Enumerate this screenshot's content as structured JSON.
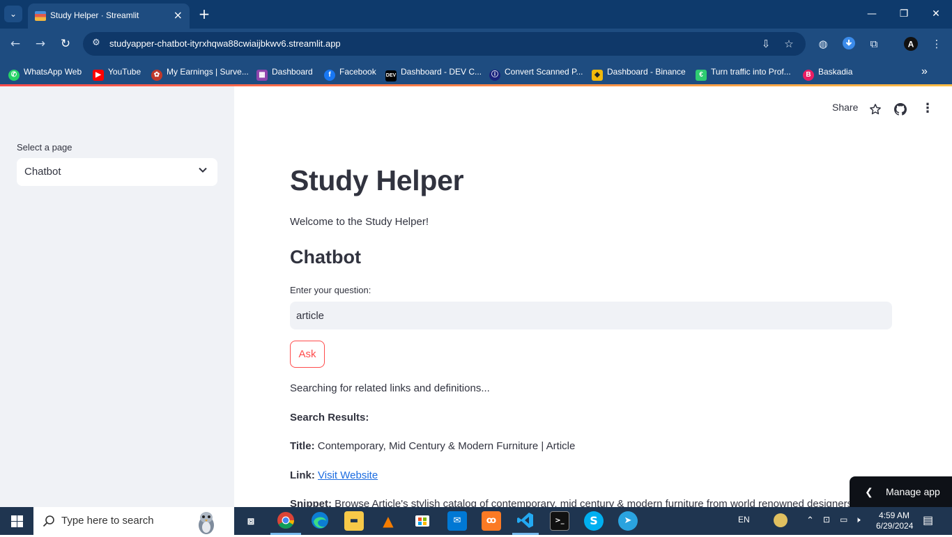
{
  "browser": {
    "tab_title": "Study Helper · Streamlit",
    "new_tab_symbol": "+",
    "url": "studyapper-chatbot-ityrxhqwa88cwiaijbkwv6.streamlit.app",
    "bookmarks": [
      {
        "label": "WhatsApp Web",
        "icon": "whatsapp-icon",
        "color": "#25d366"
      },
      {
        "label": "YouTube",
        "icon": "youtube-icon",
        "color": "#ff0000"
      },
      {
        "label": "My Earnings | Surve...",
        "icon": "earnings-icon",
        "color": "#c0392b"
      },
      {
        "label": "Dashboard",
        "icon": "dashboard-icon",
        "color": "#8e44ad"
      },
      {
        "label": "Facebook",
        "icon": "facebook-icon",
        "color": "#1877f2"
      },
      {
        "label": "Dashboard - DEV C...",
        "icon": "dev-icon",
        "color": "#000000"
      },
      {
        "label": "Convert Scanned P...",
        "icon": "convert-icon",
        "color": "#1a237e"
      },
      {
        "label": "Dashboard - Binance",
        "icon": "binance-icon",
        "color": "#f0b90b"
      },
      {
        "label": "Turn traffic into Prof...",
        "icon": "traffic-icon",
        "color": "#2ecc71"
      },
      {
        "label": "Baskadia",
        "icon": "baskadia-icon",
        "color": "#e91e63"
      }
    ]
  },
  "sidebar": {
    "select_label": "Select a page",
    "selected_page": "Chatbot"
  },
  "header": {
    "share_label": "Share"
  },
  "main": {
    "title": "Study Helper",
    "welcome": "Welcome to the Study Helper!",
    "section_title": "Chatbot",
    "question_label": "Enter your question:",
    "question_value": "article",
    "ask_label": "Ask",
    "searching_text": "Searching for related links and definitions...",
    "results_heading": "Search Results:",
    "result_title_label": "Title:",
    "result_title": "Contemporary, Mid Century & Modern Furniture | Article",
    "result_link_label": "Link:",
    "result_link_text": "Visit Website",
    "result_snippet_label": "Snippet:",
    "result_snippet": "Browse Article's stylish catalog of contemporary, mid century & modern furniture from world renowned designers"
  },
  "manage_app": {
    "label": "Manage app"
  },
  "taskbar": {
    "search_placeholder": "Type here to search",
    "language": "EN",
    "time": "4:59 AM",
    "date": "6/29/2024"
  },
  "colors": {
    "accent": "#ff4b4b",
    "link": "#1c6ce0",
    "sidebar_bg": "#f0f2f6",
    "chrome_frame": "#1e4c80"
  }
}
